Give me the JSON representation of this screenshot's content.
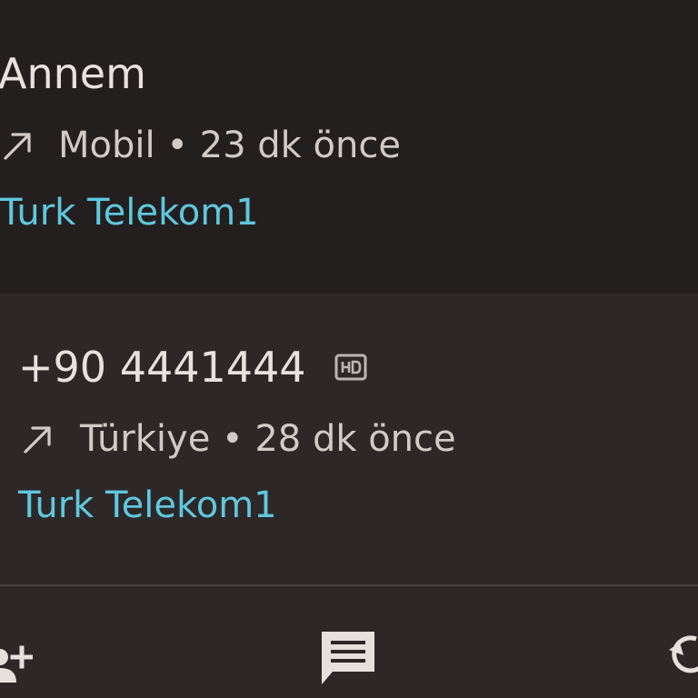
{
  "calls": [
    {
      "name": "Annem",
      "direction_icon": "outgoing-call-arrow-icon",
      "detail": "Mobil • 23 dk önce",
      "carrier": "Turk Telekom1"
    },
    {
      "name": "+90 4441444",
      "badge_icon": "hd-icon",
      "direction_icon": "outgoing-call-arrow-icon",
      "detail": "Türkiye • 28 dk önce",
      "carrier": "Turk Telekom1"
    }
  ],
  "actions": [
    {
      "icon": "add-contact-icon"
    },
    {
      "icon": "message-icon"
    },
    {
      "icon": "call-back-icon"
    }
  ],
  "colors": {
    "background": "#231f1e",
    "expanded_background": "#2d2827",
    "primary_text": "#e8e2df",
    "secondary_text": "#d2cac6",
    "carrier_text": "#5ec8de"
  }
}
